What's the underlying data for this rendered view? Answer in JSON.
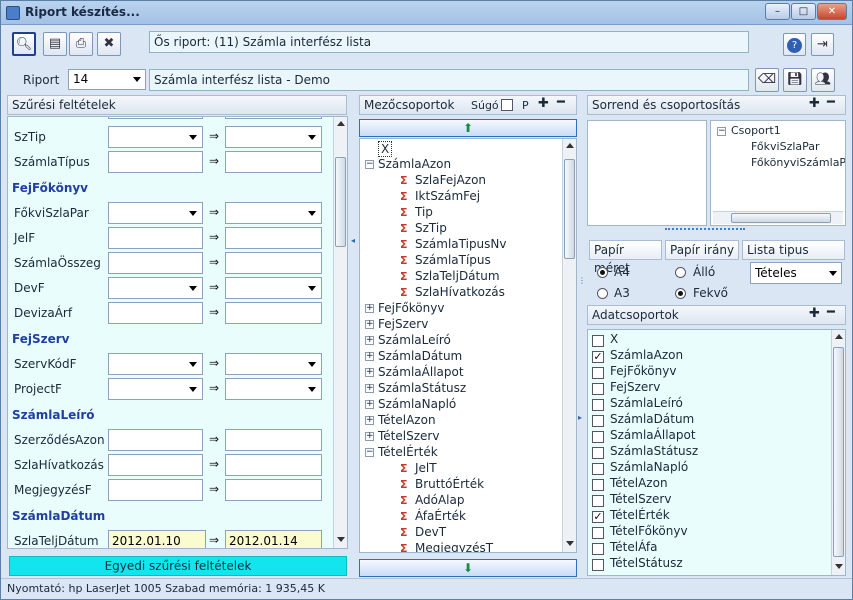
{
  "window": {
    "title": "Riport készítés...",
    "caption_minimize": "–",
    "caption_restore": "□",
    "caption_close": "✕"
  },
  "toolbar": {
    "report_caption": "Ős riport: (11)  Számla interfész lista"
  },
  "report": {
    "label": "Riport",
    "number": "14",
    "name": "Számla interfész lista - Demo"
  },
  "filters": {
    "header": "Szűrési feltételek",
    "arrow": "⇒",
    "rows": [
      {
        "label": "SzTip",
        "kind": "combo"
      },
      {
        "label": "SzámlaTípus",
        "kind": "edit"
      }
    ],
    "sections": [
      {
        "title": "FejFőkönyv",
        "rows": [
          "FőkviSzlaPar",
          "JelF",
          "SzámlaÖsszeg",
          "DevF",
          "DevizaÁrf"
        ]
      },
      {
        "title": "FejSzerv",
        "rows": [
          "SzervKódF",
          "ProjectF"
        ]
      },
      {
        "title": "SzámlaLeíró",
        "rows": [
          "SzerződésAzon",
          "SzlaHívatkozás",
          "MegjegyzésF"
        ]
      },
      {
        "title": "SzámlaDátum",
        "rows": [
          "SzlaTeljDátum"
        ]
      }
    ],
    "date_from": "2012.01.10",
    "date_to": "2012.01.14",
    "custom_button": "Egyedi szűrési feltételek"
  },
  "fields": {
    "header": "Mezőcsoportok",
    "help_label": "Súgó",
    "p_label": "P",
    "tree": [
      {
        "label": "X",
        "level": 0,
        "exp": "",
        "sig": false
      },
      {
        "label": "SzámlaAzon",
        "level": 0,
        "exp": "−",
        "sig": false
      },
      {
        "label": "SzlaFejAzon",
        "level": 1,
        "exp": "",
        "sig": true
      },
      {
        "label": "IktSzámFej",
        "level": 1,
        "exp": "",
        "sig": true
      },
      {
        "label": "Tip",
        "level": 1,
        "exp": "",
        "sig": true
      },
      {
        "label": "SzTip",
        "level": 1,
        "exp": "",
        "sig": true
      },
      {
        "label": "SzámlaTipusNv",
        "level": 1,
        "exp": "",
        "sig": true
      },
      {
        "label": "SzámlaTípus",
        "level": 1,
        "exp": "",
        "sig": true
      },
      {
        "label": "SzlaTeljDátum",
        "level": 1,
        "exp": "",
        "sig": true
      },
      {
        "label": "SzlaHívatkozás",
        "level": 1,
        "exp": "",
        "sig": true
      },
      {
        "label": "FejFőkönyv",
        "level": 0,
        "exp": "+",
        "sig": false
      },
      {
        "label": "FejSzerv",
        "level": 0,
        "exp": "+",
        "sig": false
      },
      {
        "label": "SzámlaLeíró",
        "level": 0,
        "exp": "+",
        "sig": false
      },
      {
        "label": "SzámlaDátum",
        "level": 0,
        "exp": "+",
        "sig": false
      },
      {
        "label": "SzámlaÁllapot",
        "level": 0,
        "exp": "+",
        "sig": false
      },
      {
        "label": "SzámlaStátusz",
        "level": 0,
        "exp": "+",
        "sig": false
      },
      {
        "label": "SzámlaNapló",
        "level": 0,
        "exp": "+",
        "sig": false
      },
      {
        "label": "TételAzon",
        "level": 0,
        "exp": "+",
        "sig": false
      },
      {
        "label": "TételSzerv",
        "level": 0,
        "exp": "+",
        "sig": false
      },
      {
        "label": "TételÉrték",
        "level": 0,
        "exp": "−",
        "sig": false
      },
      {
        "label": "JelT",
        "level": 1,
        "exp": "",
        "sig": true
      },
      {
        "label": "BruttóÉrték",
        "level": 1,
        "exp": "",
        "sig": true
      },
      {
        "label": "AdóAlap",
        "level": 1,
        "exp": "",
        "sig": true
      },
      {
        "label": "ÁfaÉrték",
        "level": 1,
        "exp": "",
        "sig": true
      },
      {
        "label": "DevT",
        "level": 1,
        "exp": "",
        "sig": true
      },
      {
        "label": "MegjegyzésT",
        "level": 1,
        "exp": "",
        "sig": true
      }
    ]
  },
  "order": {
    "header": "Sorrend és csoportosítás",
    "tree": [
      {
        "label": "Csoport1",
        "level": 0
      },
      {
        "label": "FőkviSzlaPar",
        "level": 1
      },
      {
        "label": "FőkönyviSzámlaPar",
        "level": 1
      }
    ],
    "paper_size_label": "Papír méret",
    "paper_dir_label": "Papír irány",
    "list_type_label": "Lista tipus",
    "a4": "A4",
    "a3": "A3",
    "standing": "Álló",
    "lying": "Fekvő",
    "list_type_value": "Tételes"
  },
  "datagroups": {
    "header": "Adatcsoportok",
    "items": [
      {
        "label": "X",
        "checked": false
      },
      {
        "label": "SzámlaAzon",
        "checked": true
      },
      {
        "label": "FejFőkönyv",
        "checked": false
      },
      {
        "label": "FejSzerv",
        "checked": false
      },
      {
        "label": "SzámlaLeíró",
        "checked": false
      },
      {
        "label": "SzámlaDátum",
        "checked": false
      },
      {
        "label": "SzámlaÁllapot",
        "checked": false
      },
      {
        "label": "SzámlaStátusz",
        "checked": false
      },
      {
        "label": "SzámlaNapló",
        "checked": false
      },
      {
        "label": "TételAzon",
        "checked": false
      },
      {
        "label": "TételSzerv",
        "checked": false
      },
      {
        "label": "TételÉrték",
        "checked": true
      },
      {
        "label": "TételFőkönyv",
        "checked": false
      },
      {
        "label": "TételÁfa",
        "checked": false
      },
      {
        "label": "TételStátusz",
        "checked": false
      }
    ]
  },
  "status": {
    "text": "Nyomtató: hp LaserJet 1005 Szabad memória: 1 935,45 K"
  }
}
